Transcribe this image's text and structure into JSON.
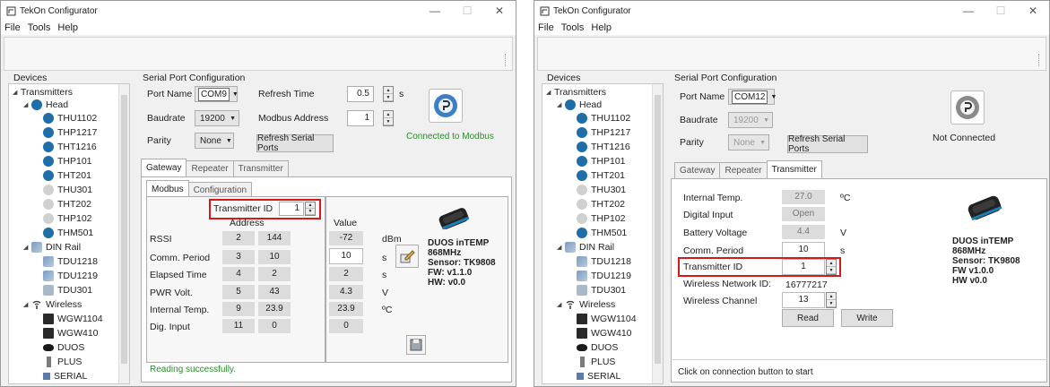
{
  "left": {
    "title": "TekOn Configurator",
    "menu": [
      "File",
      "Tools",
      "Help"
    ],
    "devices_label": "Devices",
    "tree": [
      "Transmitters",
      "Head",
      "THU1102",
      "THP1217",
      "THT1216",
      "THP101",
      "THT201",
      "THU301",
      "THT202",
      "THP102",
      "THM501",
      "DIN Rail",
      "TDU1218",
      "TDU1219",
      "TDU301",
      "Wireless",
      "WGW1104",
      "WGW410",
      "DUOS",
      "PLUS",
      "SERIAL"
    ],
    "serial_title": "Serial Port Configuration",
    "port_name_label": "Port Name",
    "port_name_value": "COM9",
    "baudrate_label": "Baudrate",
    "baudrate_value": "19200",
    "parity_label": "Parity",
    "parity_value": "None",
    "refresh_time_label": "Refresh Time",
    "refresh_time_value": "0.5",
    "refresh_time_unit": "s",
    "modbus_address_label": "Modbus Address",
    "modbus_address_value": "1",
    "refresh_ports_label": "Refresh Serial Ports",
    "connection_status": "Connected to Modbus",
    "tabs": [
      "Gateway",
      "Repeater",
      "Transmitter"
    ],
    "subtabs": [
      "Modbus",
      "Configuration"
    ],
    "transmitter_id_label": "Transmitter ID",
    "transmitter_id_value": "1",
    "address_header": "Address",
    "value_header": "Value",
    "rows": [
      {
        "label": "RSSI",
        "a1": "2",
        "a2": "144",
        "value": "-72",
        "unit": "dBm"
      },
      {
        "label": "Comm. Period",
        "a1": "3",
        "a2": "10",
        "value": "10",
        "unit": "s"
      },
      {
        "label": "Elapsed Time",
        "a1": "4",
        "a2": "2",
        "value": "2",
        "unit": "s"
      },
      {
        "label": "PWR Volt.",
        "a1": "5",
        "a2": "43",
        "value": "4.3",
        "unit": "V"
      },
      {
        "label": "Internal Temp.",
        "a1": "9",
        "a2": "23.9",
        "value": "23.9",
        "unit": "ºC"
      },
      {
        "label": "Dig. Input",
        "a1": "11",
        "a2": "0",
        "value": "0",
        "unit": ""
      }
    ],
    "device_info": [
      "DUOS inTEMP",
      "868MHz",
      "Sensor: TK9808",
      "FW: v1.1.0",
      "HW: v0.0"
    ],
    "status_text": "Reading successfully.",
    "status_color": "#2e8b2e"
  },
  "right": {
    "title": "TekOn Configurator",
    "menu": [
      "File",
      "Tools",
      "Help"
    ],
    "devices_label": "Devices",
    "tree": [
      "Transmitters",
      "Head",
      "THU1102",
      "THP1217",
      "THT1216",
      "THP101",
      "THT201",
      "THU301",
      "THT202",
      "THP102",
      "THM501",
      "DIN Rail",
      "TDU1218",
      "TDU1219",
      "TDU301",
      "Wireless",
      "WGW1104",
      "WGW410",
      "DUOS",
      "PLUS",
      "SERIAL"
    ],
    "serial_title": "Serial Port Configuration",
    "port_name_label": "Port Name",
    "port_name_value": "COM12",
    "baudrate_label": "Baudrate",
    "baudrate_value": "19200",
    "parity_label": "Parity",
    "parity_value": "None",
    "refresh_ports_label": "Refresh Serial Ports",
    "connection_status": "Not Connected",
    "tabs": [
      "Gateway",
      "Repeater",
      "Transmitter"
    ],
    "fields": [
      {
        "label": "Internal Temp.",
        "value": "27.0",
        "unit": "ºC"
      },
      {
        "label": "Digital Input",
        "value": "Open",
        "unit": ""
      },
      {
        "label": "Battery Voltage",
        "value": "4.4",
        "unit": "V"
      },
      {
        "label": "Comm. Period",
        "value": "10",
        "unit": "s"
      },
      {
        "label": "Transmitter ID",
        "value": "1",
        "unit": ""
      },
      {
        "label": "Wireless Network ID:",
        "value": "16777217",
        "unit": ""
      },
      {
        "label": "Wireless Channel",
        "value": "13",
        "unit": ""
      }
    ],
    "read_label": "Read",
    "write_label": "Write",
    "device_info": [
      "DUOS inTEMP",
      "868MHz",
      "Sensor: TK9808",
      "FW v1.0.0",
      "HW v0.0"
    ],
    "status_text": "Click on connection button to start"
  },
  "highlight_color": "#d21a1a"
}
